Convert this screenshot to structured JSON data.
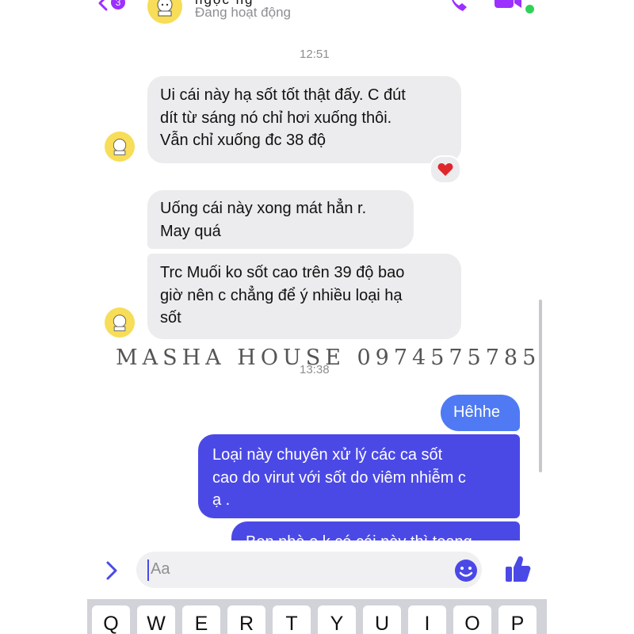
{
  "header": {
    "contact_name": "ngọc ng",
    "status": "Đang hoạt động"
  },
  "colors": {
    "outgoing_bubble": "#4b49e6",
    "outgoing_light_bubble": "#4f7af3",
    "incoming_bubble": "#ececee",
    "accent": "#4b49e6",
    "avatar_bg": "#f7dd58"
  },
  "timestamps": {
    "first": "12:51",
    "second": "13:38"
  },
  "messages": {
    "m1": [
      "Ui cái này hạ sốt tốt thật đấy. C đút",
      "dít từ sáng nó chỉ hơi xuống thôi.",
      "Vẫn chỉ xuống đc 38 độ"
    ],
    "m1_reaction": "heart",
    "m2": [
      "Uống cái này xong mát hẳn r.",
      "May quá"
    ],
    "m3": [
      "Trc Muối ko sốt cao trên 39 độ bao",
      "giờ nên c chẳng để ý nhiều loại hạ",
      "sốt"
    ],
    "m4": "Hêhhe",
    "m5": [
      "Loại này chuyên xử lý các ca sốt",
      "cao do virut với sốt do viêm nhiễm c",
      "ạ ."
    ],
    "m6": "Bọn nhà e k có cái này thì toang"
  },
  "watermark": "MASHA HOUSE 0974575785",
  "composer": {
    "placeholder": "Aa"
  },
  "keyboard": {
    "keys": [
      "Q",
      "W",
      "E",
      "R",
      "T",
      "Y",
      "U",
      "I",
      "O",
      "P"
    ]
  },
  "icons": [
    "back-icon",
    "call-icon",
    "video-icon",
    "chevron-right-icon",
    "emoji-icon",
    "thumbs-up-icon",
    "heart-icon"
  ]
}
